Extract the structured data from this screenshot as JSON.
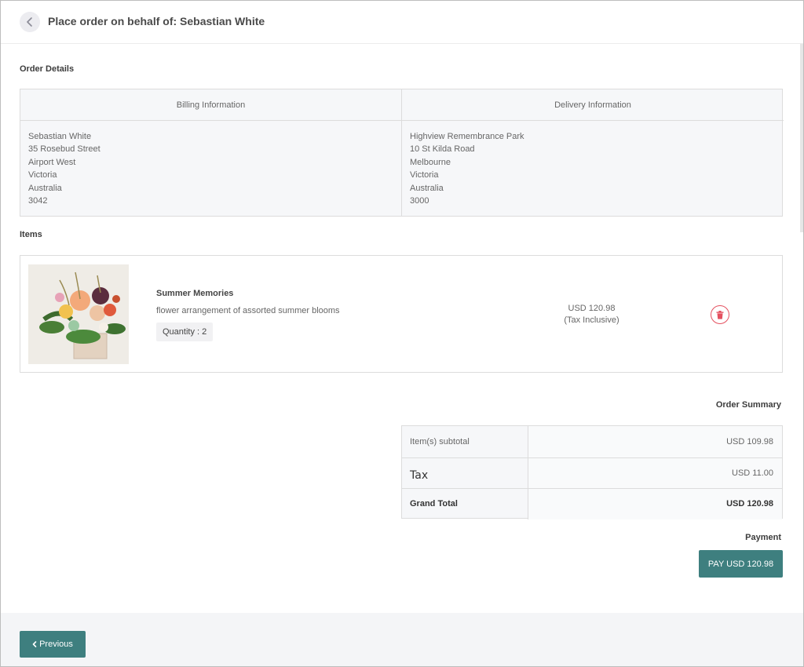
{
  "header": {
    "title": "Place order on behalf of: Sebastian  White"
  },
  "order_details": {
    "title": "Order Details",
    "billing": {
      "heading": "Billing Information",
      "lines": [
        "Sebastian  White",
        "35 Rosebud Street",
        "Airport West",
        "Victoria",
        "Australia",
        "3042"
      ]
    },
    "delivery": {
      "heading": "Delivery Information",
      "lines": [
        "Highview Remembrance Park",
        "10 St Kilda Road",
        "Melbourne",
        "Victoria",
        "Australia",
        "3000"
      ]
    }
  },
  "items": {
    "title": "Items",
    "list": [
      {
        "name": "Summer Memories",
        "description": "flower arrangement of assorted summer blooms",
        "quantity_label": "Quantity : 2",
        "price": "USD 120.98",
        "price_note": "(Tax Inclusive)",
        "delete_icon": "trash-icon"
      }
    ]
  },
  "summary": {
    "title": "Order Summary",
    "rows": [
      {
        "label": "Item(s) subtotal",
        "value": "USD 109.98"
      },
      {
        "label": "Tax",
        "value": "USD 11.00"
      },
      {
        "label": "Grand Total",
        "value": "USD 120.98"
      }
    ]
  },
  "payment": {
    "title": "Payment",
    "pay_label": "PAY USD 120.98"
  },
  "footer": {
    "previous_label": "Previous"
  },
  "colors": {
    "primary": "#3e7f7f",
    "danger": "#e4505f"
  }
}
